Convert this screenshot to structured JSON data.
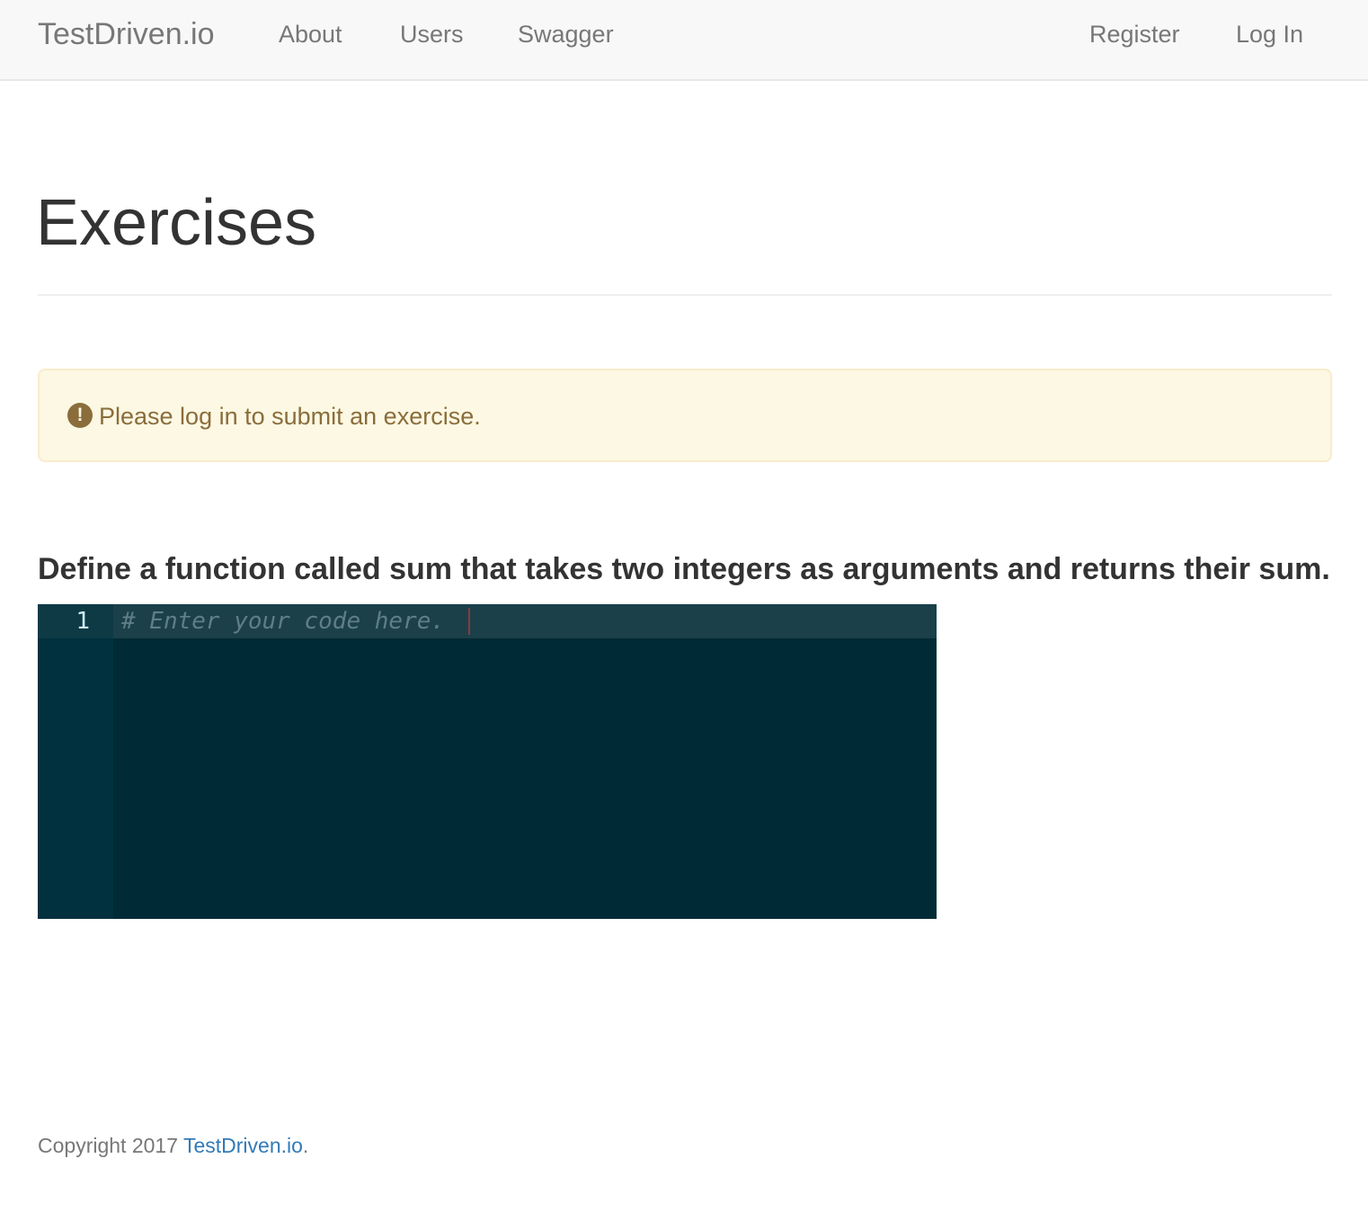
{
  "navbar": {
    "brand": "TestDriven.io",
    "links": {
      "about": "About",
      "users": "Users",
      "swagger": "Swagger",
      "register": "Register",
      "login": "Log In"
    }
  },
  "page": {
    "title": "Exercises"
  },
  "alert": {
    "icon": "exclamation-circle-icon",
    "icon_glyph": "!",
    "message": "Please log in to submit an exercise.",
    "color": "#8a6d3b",
    "background": "#fcf8e3"
  },
  "exercise": {
    "description": "Define a function called sum that takes two integers as arguments and returns their sum.",
    "editor": {
      "line_number": "1",
      "placeholder": "# Enter your code here.",
      "theme_background": "#002b36"
    }
  },
  "footer": {
    "prefix": "Copyright 2017 ",
    "link_text": "TestDriven.io",
    "suffix": ".",
    "link_color": "#337ab7"
  }
}
